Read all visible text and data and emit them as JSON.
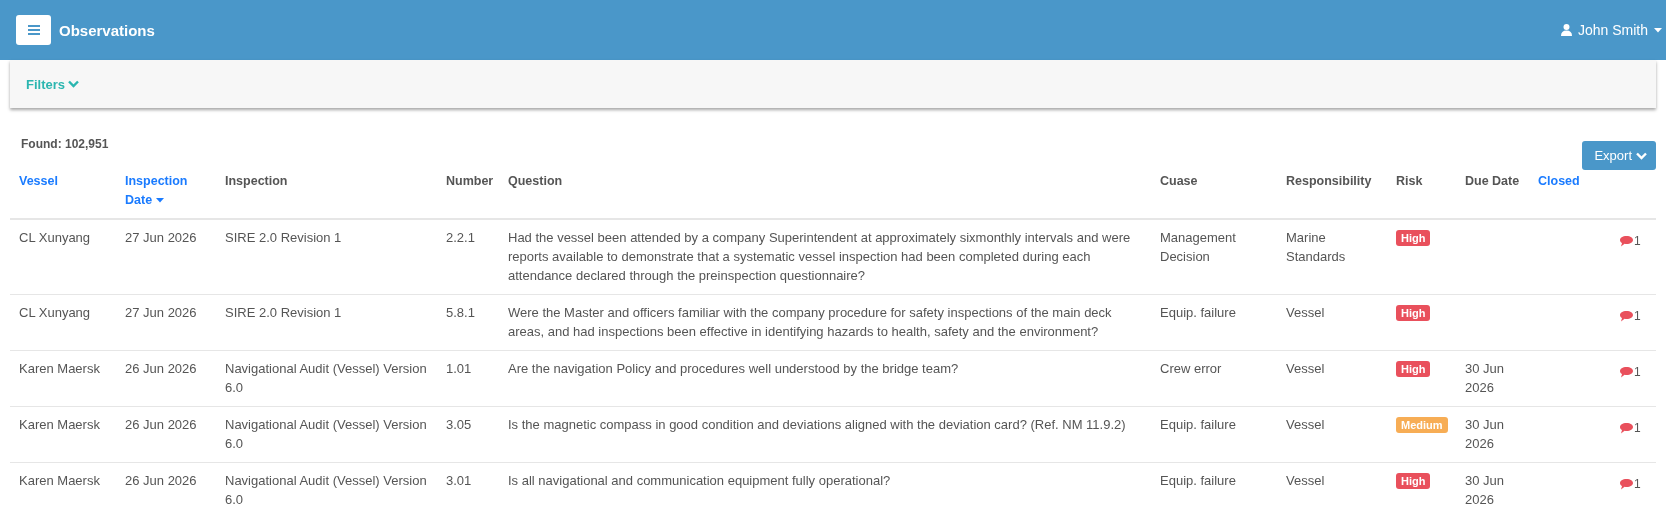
{
  "header": {
    "title": "Observations",
    "user": "John Smith"
  },
  "filters": {
    "label": "Filters"
  },
  "found": "Found: 102,951",
  "export_button": "Export",
  "table": {
    "columns": [
      {
        "label": "Vessel",
        "sortable": true,
        "sorted": false
      },
      {
        "label": "Inspection Date",
        "sortable": true,
        "sorted": true
      },
      {
        "label": "Inspection",
        "sortable": false,
        "sorted": false
      },
      {
        "label": "Number",
        "sortable": false,
        "sorted": false
      },
      {
        "label": "Question",
        "sortable": false,
        "sorted": false
      },
      {
        "label": "Cuase",
        "sortable": false,
        "sorted": false
      },
      {
        "label": "Responsibility",
        "sortable": false,
        "sorted": false
      },
      {
        "label": "Risk",
        "sortable": false,
        "sorted": false
      },
      {
        "label": "Due Date",
        "sortable": false,
        "sorted": false
      },
      {
        "label": "Closed",
        "sortable": true,
        "sorted": false
      }
    ],
    "rows": [
      {
        "vessel": "CL Xunyang",
        "inspection_date": "27 Jun 2026",
        "inspection": "SIRE 2.0 Revision 1",
        "number": "2.2.1",
        "question": "Had the vessel been attended by a company Superintendent at approximately sixmonthly intervals and were reports available to demonstrate that a systematic vessel inspection had been completed during each attendance declared through the preinspection questionnaire?",
        "cause": "Management Decision",
        "responsibility": "Marine Standards",
        "risk": {
          "label": "High",
          "color": "#e9505c"
        },
        "comments": "1"
      },
      {
        "vessel": "CL Xunyang",
        "inspection_date": "27 Jun 2026",
        "inspection": "SIRE 2.0 Revision 1",
        "number": "5.8.1",
        "question": "Were the Master and officers familiar with the company procedure for safety inspections of the main deck areas, and had inspections been effective in identifying hazards to health, safety and the environment?",
        "cause": "Equip. failure",
        "responsibility": "Vessel",
        "risk": {
          "label": "High",
          "color": "#e9505c"
        },
        "comments": "1"
      },
      {
        "vessel": "Karen Maersk",
        "inspection_date": "26 Jun 2026",
        "inspection": "Navigational Audit (Vessel) Version 6.0",
        "number": "1.01",
        "question": "Are the navigation Policy and procedures well understood by the bridge team?",
        "cause": "Crew error",
        "responsibility": "Vessel",
        "risk": {
          "label": "High",
          "color": "#e9505c"
        },
        "due_date": "30 Jun 2026",
        "comments": "1"
      },
      {
        "vessel": "Karen Maersk",
        "inspection_date": "26 Jun 2026",
        "inspection": "Navigational Audit (Vessel) Version 6.0",
        "number": "3.05",
        "question": "Is the magnetic compass in good condition and deviations aligned with the deviation card? (Ref. NM 11.9.2)",
        "cause": "Equip. failure",
        "responsibility": "Vessel",
        "risk": {
          "label": "Medium",
          "color": "#f7ad55"
        },
        "due_date": "30 Jun 2026",
        "comments": "1"
      },
      {
        "vessel": "Karen Maersk",
        "inspection_date": "26 Jun 2026",
        "inspection": "Navigational Audit (Vessel) Version 6.0",
        "number": "3.01",
        "question": "Is all navigational and communication equipment fully operational?",
        "cause": "Equip. failure",
        "responsibility": "Vessel",
        "risk": {
          "label": "High",
          "color": "#e9505c"
        },
        "due_date": "30 Jun 2026",
        "comments": "1"
      }
    ]
  }
}
